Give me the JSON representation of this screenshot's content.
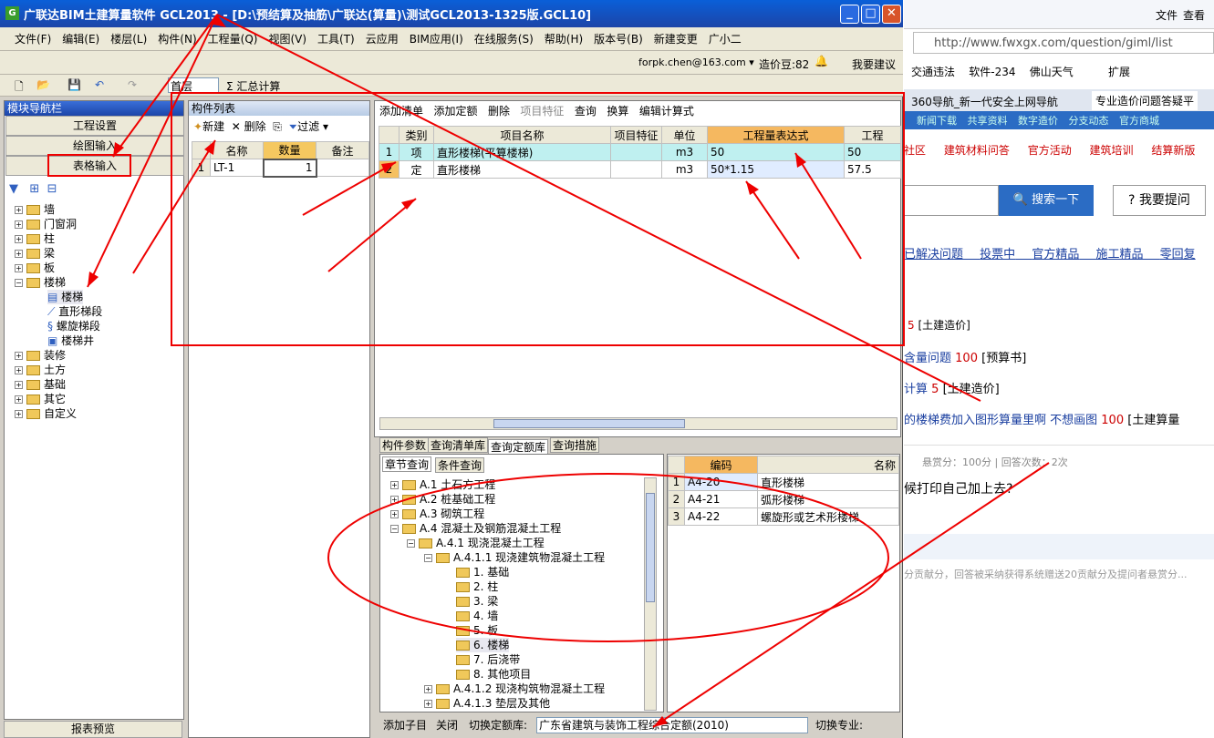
{
  "window": {
    "title": "广联达BIM土建算量软件 GCL2013 - [D:\\预结算及抽筋\\广联达(算量)\\测试GCL2013-1325版.GCL10]",
    "min": "_",
    "max": "□",
    "close": "✕"
  },
  "menu": [
    "文件(F)",
    "编辑(E)",
    "楼层(L)",
    "构件(N)",
    "工程量(Q)",
    "视图(V)",
    "工具(T)",
    "云应用",
    "BIM应用(I)",
    "在线服务(S)",
    "帮助(H)",
    "版本号(B)",
    "新建变更",
    "广小二"
  ],
  "toolbar2": {
    "email": "forpk.chen@163.com ▾",
    "beans": "造价豆:82",
    "suggest": "我要建议"
  },
  "toolbar3": {
    "floor": "首层",
    "sum": "汇总计算"
  },
  "nav": {
    "title": "模块导航栏",
    "buttons": [
      "工程设置",
      "绘图输入",
      "表格输入"
    ],
    "tree": [
      "墙",
      "门窗洞",
      "柱",
      "梁",
      "板",
      "楼梯",
      "楼梯",
      "直形梯段",
      "螺旋梯段",
      "楼梯井",
      "装修",
      "土方",
      "基础",
      "其它",
      "自定义"
    ],
    "report": "报表预览"
  },
  "complist": {
    "title": "构件列表",
    "new": "新建",
    "delete": "删除",
    "filter": "过滤",
    "headers": [
      "名称",
      "数量",
      "备注"
    ],
    "rows": [
      [
        "1",
        "LT-1",
        "1"
      ]
    ]
  },
  "main": {
    "toolbar": [
      "添加清单",
      "添加定额",
      "删除",
      "项目特征",
      "查询",
      "换算",
      "编辑计算式"
    ],
    "headers": [
      "类别",
      "项目名称",
      "项目特征",
      "单位",
      "工程量表达式",
      "工程"
    ],
    "rows": [
      [
        "1",
        "项",
        "直形楼梯(平算楼梯)",
        "",
        "m3",
        "50",
        "50"
      ],
      [
        "2",
        "定",
        "直形楼梯",
        "",
        "m3",
        "50*1.15",
        "57.5"
      ]
    ]
  },
  "lower": {
    "tabs": [
      "构件参数",
      "查询清单库",
      "查询定额库",
      "查询措施"
    ],
    "subtabs": [
      "章节查询",
      "条件查询"
    ],
    "tree": [
      "A.1 土石方工程",
      "A.2 桩基础工程",
      "A.3 砌筑工程",
      "A.4 混凝土及钢筋混凝土工程",
      "A.4.1 现浇混凝土工程",
      "A.4.1.1 现浇建筑物混凝土工程",
      "1. 基础",
      "2. 柱",
      "3. 梁",
      "4. 墙",
      "5. 板",
      "6. 楼梯",
      "7. 后浇带",
      "8. 其他项目",
      "A.4.1.2 现浇构筑物混凝土工程",
      "A.4.1.3 垫层及其他"
    ],
    "codehdr": [
      "编码",
      "名称"
    ],
    "coderows": [
      [
        "1",
        "A4-20",
        "直形楼梯"
      ],
      [
        "2",
        "A4-21",
        "弧形楼梯"
      ],
      [
        "3",
        "A4-22",
        "螺旋形或艺术形楼梯"
      ]
    ],
    "status": {
      "addchild": "添加子目",
      "close": "关闭",
      "switch": "切换定额库:",
      "lib": "广东省建筑与装饰工程综合定额(2010)",
      "major": "切换专业:"
    }
  },
  "browser": {
    "topright": [
      "文件",
      "查看"
    ],
    "url": "http://www.fwxgx.com/question/giml/list",
    "favs": [
      "交通违法",
      "软件-234",
      "佛山天气"
    ],
    "ext": "扩展",
    "tabs": [
      "360导航_新一代安全上网导航",
      "专业造价问题答疑平"
    ],
    "nav1": [
      "新闻下载",
      "共享资料",
      "数字造价",
      "分支动态",
      "官方商城"
    ],
    "nav2": [
      "社区",
      "建筑材料问答",
      "官方活动",
      "建筑培训",
      "结算新版"
    ],
    "search": "搜索一下",
    "ask": "我要提问",
    "filters": [
      "已解决问题",
      "投票中",
      "官方精品",
      "施工精品",
      "零回复"
    ],
    "items": [
      {
        "n": "5",
        "t": "[土建造价]",
        "p": ""
      },
      {
        "n": "100",
        "t": "[预算书]",
        "p": "含量问题"
      },
      {
        "n": "5",
        "t": "[土建造价]",
        "p": "计算"
      },
      {
        "n": "100",
        "t": "[土建算量",
        "p": "的楼梯费加入图形算量里啊 不想画图"
      }
    ],
    "meta": "悬赏分：100分 | 回答次数：2次",
    "q": "候打印自己加上去?",
    "foot": "分贡献分，回答被采纳获得系统赠送20贡献分及提问者悬赏分..."
  }
}
